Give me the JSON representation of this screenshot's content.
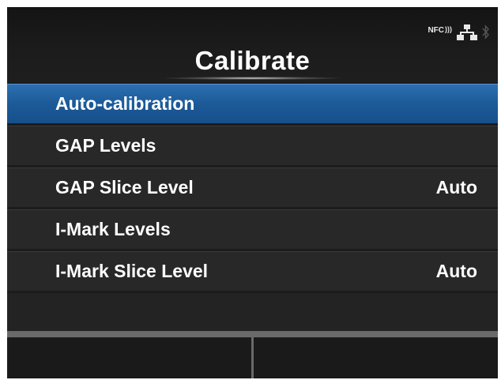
{
  "header": {
    "title": "Calibrate",
    "status_icons": {
      "nfc_label": "NFC",
      "icons": [
        "nfc-icon",
        "network-icon",
        "bluetooth-icon"
      ]
    }
  },
  "menu": {
    "items": [
      {
        "label": "Auto-calibration",
        "value": "",
        "selected": true
      },
      {
        "label": "GAP Levels",
        "value": "",
        "selected": false
      },
      {
        "label": "GAP Slice Level",
        "value": "Auto",
        "selected": false
      },
      {
        "label": "I-Mark Levels",
        "value": "",
        "selected": false
      },
      {
        "label": "I-Mark Slice Level",
        "value": "Auto",
        "selected": false
      }
    ]
  },
  "colors": {
    "selected_row": "#1c5a98",
    "row": "#282828",
    "background": "#1c1c1c"
  }
}
